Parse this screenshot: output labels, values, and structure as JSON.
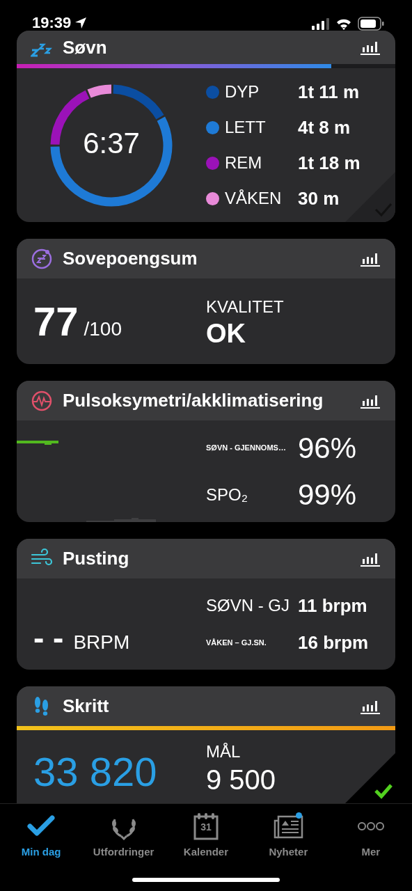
{
  "status_bar": {
    "time": "19:39",
    "location_active": true
  },
  "cards": [
    {
      "kind": "sleep",
      "title": "Søvn",
      "bar": {
        "level": 0.83
      },
      "total": "6:37",
      "goal_met": false,
      "stages": [
        {
          "name": "DYP",
          "value": "1t 11 m",
          "color": "#0b4ea2"
        },
        {
          "name": "LETT",
          "value": "4t 8 m",
          "color": "#1e7ad6"
        },
        {
          "name": "REM",
          "value": "1t 18 m",
          "color": "#9b12b8"
        },
        {
          "name": "VÅKEN",
          "value": "30 m",
          "color": "#e88ad8"
        }
      ]
    },
    {
      "kind": "score",
      "title": "Sovepoengsum",
      "score": "77",
      "max": "/100",
      "quality_label": "KVALITET",
      "quality": "OK"
    },
    {
      "kind": "spo2",
      "title": "Pulsoksymetri/akklimatisering",
      "rows": [
        {
          "label": "SØVN - GJENNOMS…",
          "value": "96%",
          "small": true
        },
        {
          "label": "SPO₂",
          "value": "99%",
          "small": false
        }
      ]
    },
    {
      "kind": "breathing",
      "title": "Pusting",
      "current": "- -",
      "unit": "BRPM",
      "rows": [
        {
          "label": "SØVN - GJ",
          "value": "11 brpm",
          "small": false
        },
        {
          "label": "VÅKEN – GJ.SN.",
          "value": "16 brpm",
          "small": true
        }
      ]
    },
    {
      "kind": "steps",
      "title": "Skritt",
      "steps": "33 820",
      "goal_label": "MÅL",
      "goal": "9 500",
      "goal_met": true
    }
  ],
  "tab_bar": [
    {
      "kind": "check",
      "label": "Min dag",
      "selected": true,
      "badge": false
    },
    {
      "kind": "laurel",
      "label": "Utfordringer",
      "selected": false,
      "badge": false
    },
    {
      "kind": "calendar",
      "label": "Kalender",
      "icon_text": "31",
      "selected": false,
      "badge": false
    },
    {
      "kind": "news",
      "label": "Nyheter",
      "selected": false,
      "badge": true
    },
    {
      "kind": "more",
      "label": "Mer",
      "selected": false,
      "badge": false
    }
  ]
}
